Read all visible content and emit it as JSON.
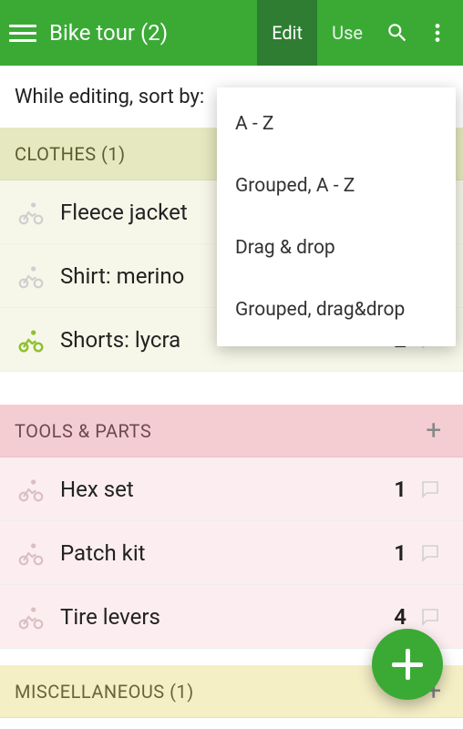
{
  "header": {
    "title": "Bike tour (2)",
    "tabs": {
      "edit": "Edit",
      "use": "Use"
    }
  },
  "sort_row": {
    "label": "While editing, sort by:"
  },
  "dropdown": {
    "items": [
      {
        "label": "A - Z"
      },
      {
        "label": "Grouped, A - Z"
      },
      {
        "label": "Drag & drop"
      },
      {
        "label": "Grouped, drag&drop"
      }
    ]
  },
  "sections": [
    {
      "id": "clothes",
      "title": "CLOTHES (1)",
      "theme": "green",
      "items": [
        {
          "label": "Fleece jacket",
          "qty": "",
          "active": false
        },
        {
          "label": "Shirt: merino",
          "qty": "",
          "active": false
        },
        {
          "label": "Shorts: lycra",
          "qty": "2",
          "active": true
        }
      ]
    },
    {
      "id": "tools",
      "title": "TOOLS & PARTS",
      "theme": "pink",
      "items": [
        {
          "label": "Hex set",
          "qty": "1",
          "active": false
        },
        {
          "label": "Patch kit",
          "qty": "1",
          "active": false
        },
        {
          "label": "Tire levers",
          "qty": "4",
          "active": false
        }
      ]
    },
    {
      "id": "misc",
      "title": "MISCELLANEOUS (1)",
      "theme": "yellow",
      "items": []
    }
  ],
  "icons": {
    "section_add": "+"
  }
}
